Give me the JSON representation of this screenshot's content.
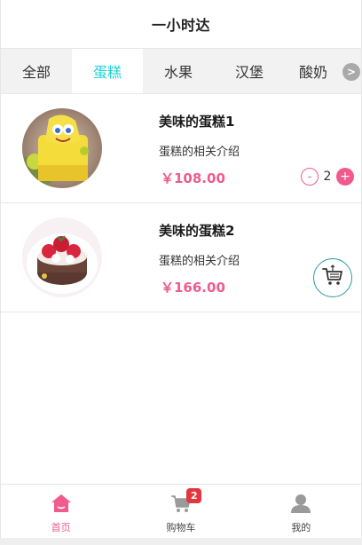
{
  "header": {
    "title": "一小时达"
  },
  "tabs": {
    "items": [
      {
        "label": "全部"
      },
      {
        "label": "蛋糕"
      },
      {
        "label": "水果"
      },
      {
        "label": "汉堡"
      },
      {
        "label": "酸奶"
      }
    ],
    "active_index": 1,
    "more_icon": "chevron-right-icon",
    "more_glyph": ">"
  },
  "products": [
    {
      "name": "美味的蛋糕1",
      "description": "蛋糕的相关介绍",
      "price": "￥108.00",
      "quantity": "2",
      "minus_label": "-",
      "plus_label": "+",
      "image_icon": "yellow-sponge-cake-image"
    },
    {
      "name": "美味的蛋糕2",
      "description": "蛋糕的相关介绍",
      "price": "￥166.00",
      "image_icon": "strawberry-chocolate-cake-image",
      "cart_icon": "shopping-cart-icon"
    }
  ],
  "bottom_nav": {
    "items": [
      {
        "label": "首页",
        "icon": "home-icon",
        "active": true
      },
      {
        "label": "购物车",
        "icon": "cart-icon",
        "badge": "2"
      },
      {
        "label": "我的",
        "icon": "user-icon"
      }
    ]
  },
  "colors": {
    "accent_pink": "#f05a8c",
    "active_tab": "#1fd1d6",
    "badge_red": "#e2373f",
    "teal_border": "#2a9aa2"
  }
}
